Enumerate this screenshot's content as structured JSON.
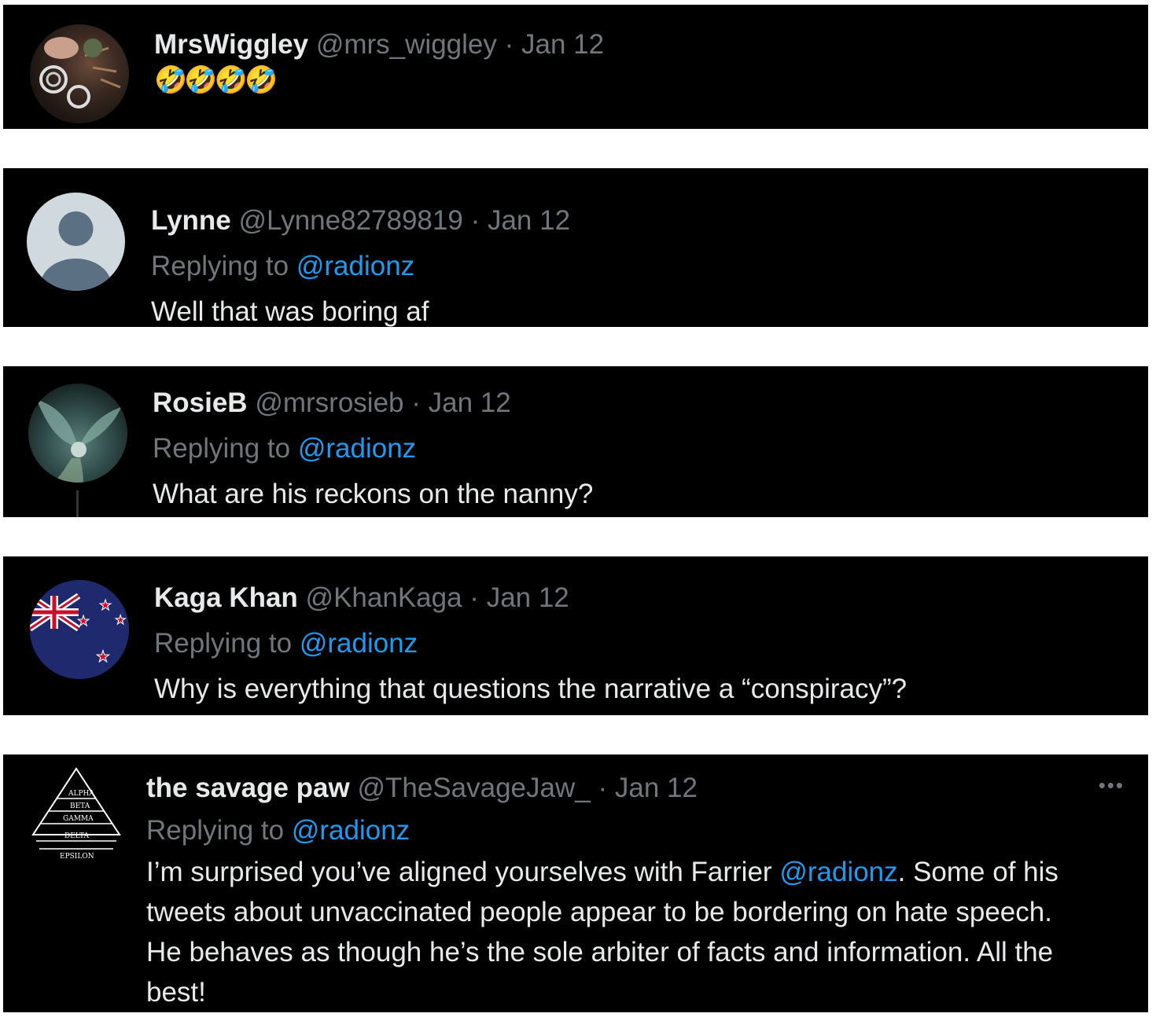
{
  "tweets": [
    {
      "name": "MrsWiggley",
      "handle": "@mrs_wiggley",
      "sep": "·",
      "date": "Jan 12",
      "text": "🤣🤣🤣🤣"
    },
    {
      "name": "Lynne",
      "handle": "@Lynne82789819",
      "sep": "·",
      "date": "Jan 12",
      "replying_prefix": "Replying to",
      "replying_to": "@radionz",
      "text": "Well that was boring af"
    },
    {
      "name": "RosieB",
      "handle": "@mrsrosieb",
      "sep": "·",
      "date": "Jan 12",
      "replying_prefix": "Replying to",
      "replying_to": "@radionz",
      "text": "What are his reckons on the nanny?"
    },
    {
      "name": "Kaga Khan",
      "handle": "@KhanKaga",
      "sep": "·",
      "date": "Jan 12",
      "replying_prefix": "Replying to",
      "replying_to": "@radionz",
      "text": "Why is everything that questions the narrative a “conspiracy”?"
    },
    {
      "name": "the savage paw",
      "handle": "@TheSavageJaw_",
      "sep": "·",
      "date": "Jan 12",
      "more": "•••",
      "replying_prefix": "Replying to",
      "replying_to": "@radionz",
      "text_line1_a": "I’m surprised you’ve aligned yourselves with Farrier ",
      "text_line1_mention": "@radionz",
      "text_line1_b": ". Some of his",
      "text_line2": "tweets about unvaccinated people appear to be bordering on hate speech.",
      "text_line3": "He behaves as though he’s the sole arbiter of facts and information. All the",
      "text_line4": "best!",
      "avatar_labels": [
        "ALPHA",
        "BETA",
        "GAMMA",
        "DELTA",
        "EPSILON"
      ]
    }
  ],
  "colors": {
    "background": "#000000",
    "text": "#e7e9ea",
    "muted": "#71767b",
    "link": "#1d9bf0"
  }
}
